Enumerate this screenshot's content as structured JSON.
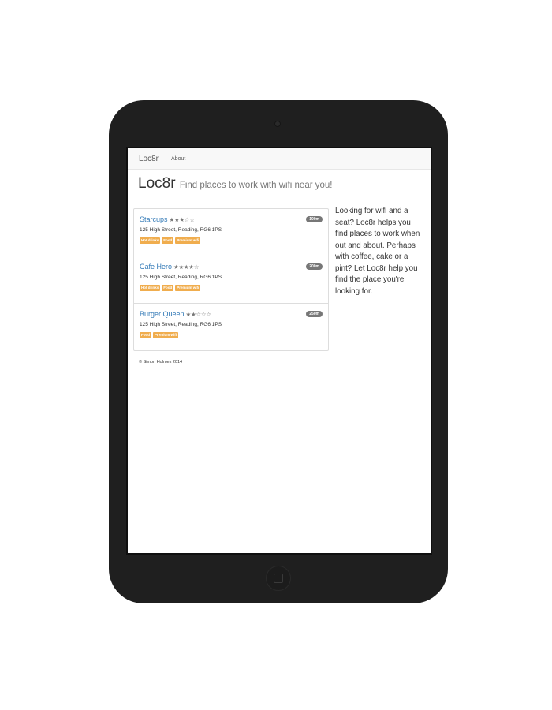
{
  "navbar": {
    "brand": "Loc8r",
    "about": "About"
  },
  "header": {
    "title": "Loc8r",
    "strapline": "Find places to work with wifi near you!"
  },
  "locations": [
    {
      "name": "Starcups",
      "stars": "★★★☆☆",
      "distance": "100m",
      "address": "125 High Street, Reading, RG6 1PS",
      "facilities": [
        "Hot drinks",
        "Food",
        "Premium wifi"
      ]
    },
    {
      "name": "Cafe Hero",
      "stars": "★★★★☆",
      "distance": "200m",
      "address": "125 High Street, Reading, RG6 1PS",
      "facilities": [
        "Hot drinks",
        "Food",
        "Premium wifi"
      ]
    },
    {
      "name": "Burger Queen",
      "stars": "★★☆☆☆",
      "distance": "250m",
      "address": "125 High Street, Reading, RG6 1PS",
      "facilities": [
        "Food",
        "Premium wifi"
      ]
    }
  ],
  "sidebar": {
    "text": "Looking for wifi and a seat? Loc8r helps you find places to work when out and about. Perhaps with coffee, cake or a pint? Let Loc8r help you find the place you're looking for."
  },
  "footer": {
    "text": "© Simon Holmes 2014"
  },
  "colors": {
    "link": "#337ab7",
    "tag": "#f0ad4e",
    "badge": "#777777",
    "device": "#1f1f1f"
  }
}
